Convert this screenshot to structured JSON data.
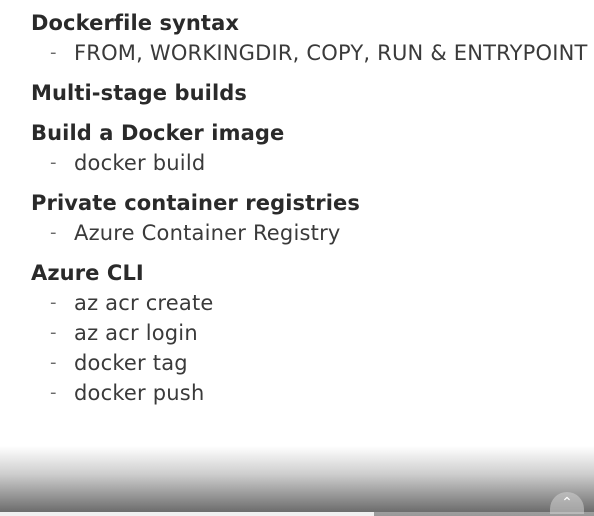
{
  "outline": {
    "sections": [
      {
        "heading": "Dockerfile syntax",
        "items": [
          "FROM, WORKINGDIR, COPY, RUN & ENTRYPOINT"
        ]
      },
      {
        "heading": "Multi-stage builds",
        "items": []
      },
      {
        "heading": "Build a Docker image",
        "items": [
          "docker build"
        ]
      },
      {
        "heading": "Private container registries",
        "items": [
          "Azure Container Registry"
        ]
      },
      {
        "heading": "Azure CLI",
        "items": [
          "az acr create",
          "az acr login",
          "docker tag",
          "docker push"
        ]
      }
    ],
    "bullet_char": "-"
  },
  "player": {
    "progress_fraction": 0.63,
    "control_icon": "chevron-up-icon"
  }
}
